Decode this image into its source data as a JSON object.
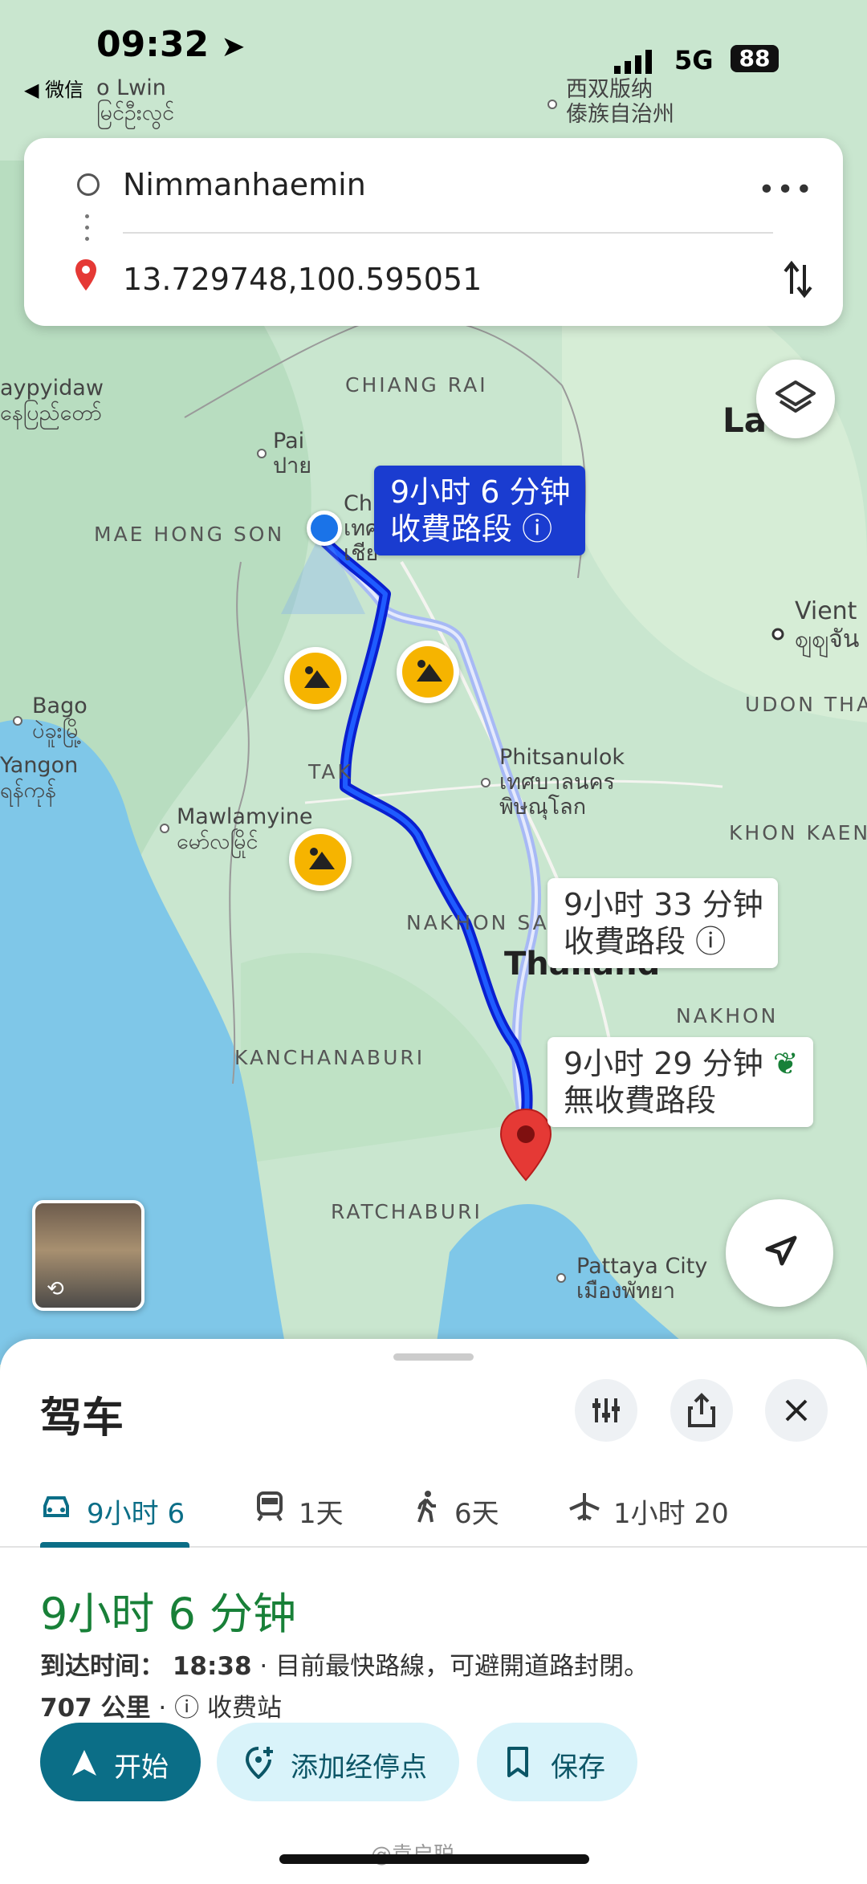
{
  "status_bar": {
    "time": "09:32",
    "back_app": "◀ 微信",
    "network": "5G",
    "battery": "88"
  },
  "search": {
    "origin": "Nimmanhaemin",
    "destination": "13.729748,100.595051"
  },
  "map": {
    "labels": {
      "xishuangbanna": "西双版纳\n傣族自治州",
      "chiang_rai": "CHIANG RAI",
      "pai": "Pai\nปาย",
      "mae_hong_son": "MAE HONG SON",
      "naypyidaw": "aypyidaw\nနေပြည်တော်",
      "lao": "Lao",
      "vientiane": "Vient\nဈဈจัน",
      "udon_thani": "UDON THA",
      "bago": "Bago\nပဲခူးမြို့",
      "yangon": "Yangon\nရန်ကုန်",
      "tak": "TAK",
      "phitsanulok": "Phitsanulok\nเทศบาลนคร\nพิษณุโลก",
      "mawlamyine": "Mawlamyine\nမော်လမြိုင်",
      "khon_kaen": "KHON KAEN",
      "nakhon_sawan": "NAKHON SA",
      "thailand": "Thailand",
      "nakhon": "NAKHON",
      "kanchanaburi": "KANCHANABURI",
      "ratchaburi": "RATCHABURI",
      "pattaya": "Pattaya City\nเมืองพัทยา",
      "po_lwin": "o Lwin\nမြင်ဦးလွင်",
      "chi": "Chi\nเทศ\nเชีย"
    },
    "callouts": [
      {
        "line1": "9小时 6 分钟",
        "line2": "收費路段 ⓘ"
      },
      {
        "line1": "9小时 33 分钟",
        "line2": "收費路段 ⓘ"
      },
      {
        "line1": "9小时 29 分钟",
        "line2": "無收費路段"
      }
    ]
  },
  "sheet": {
    "title": "驾车",
    "modes": [
      {
        "icon": "car-icon",
        "label": "9小时 6"
      },
      {
        "icon": "train-icon",
        "label": "1天"
      },
      {
        "icon": "walk-icon",
        "label": "6天"
      },
      {
        "icon": "plane-icon",
        "label": "1小时 20"
      }
    ],
    "duration": "9小时 6 分钟",
    "arrival_label": "到达时间：",
    "arrival_time": "18:38",
    "arrival_note": "· 目前最快路線，可避開道路封閉。",
    "distance": "707 公里",
    "toll_label": "收费站",
    "actions": {
      "start": "开始",
      "add_stop": "添加经停点",
      "save": "保存"
    }
  },
  "watermark": "@袁启聪",
  "colors": {
    "accent": "#0b6e87",
    "route": "#1a3cd0",
    "eta_green": "#188038",
    "water": "#7fc7e8",
    "land": "#cfe8d5"
  }
}
